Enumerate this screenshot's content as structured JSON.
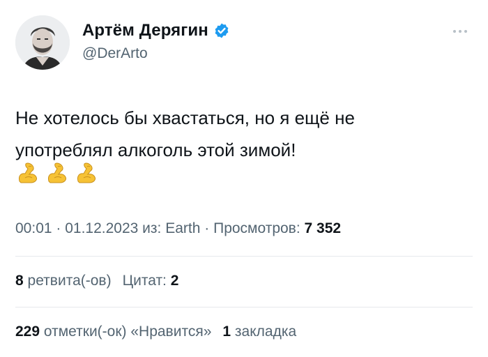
{
  "author": {
    "display_name": "Артём Дерягин",
    "handle": "@DerArto",
    "verified": true
  },
  "tweet": {
    "text_line1": "Не хотелось бы хвастаться, но я ещё не",
    "text_line2": "употреблял алкоголь этой зимой!",
    "emojis": [
      "flexed-biceps",
      "flexed-biceps",
      "flexed-biceps"
    ]
  },
  "meta": {
    "time": "00:01",
    "sep1": " · ",
    "date": "01.12.2023",
    "source_prefix": " из: ",
    "source": "Earth",
    "sep2": " · ",
    "views_label": "Просмотров: ",
    "views_count": "7 352"
  },
  "stats": {
    "retweets_count": "8",
    "retweets_label": " ретвита(-ов)",
    "quotes_label": "Цитат: ",
    "quotes_count": "2",
    "likes_count": "229",
    "likes_label": " отметки(-ок) «Нравится»",
    "bookmarks_count": "1",
    "bookmarks_label": " закладка"
  },
  "colors": {
    "text": "#0f1419",
    "secondary": "#536471",
    "verified": "#1d9bf0",
    "divider": "#e6e9ec"
  }
}
